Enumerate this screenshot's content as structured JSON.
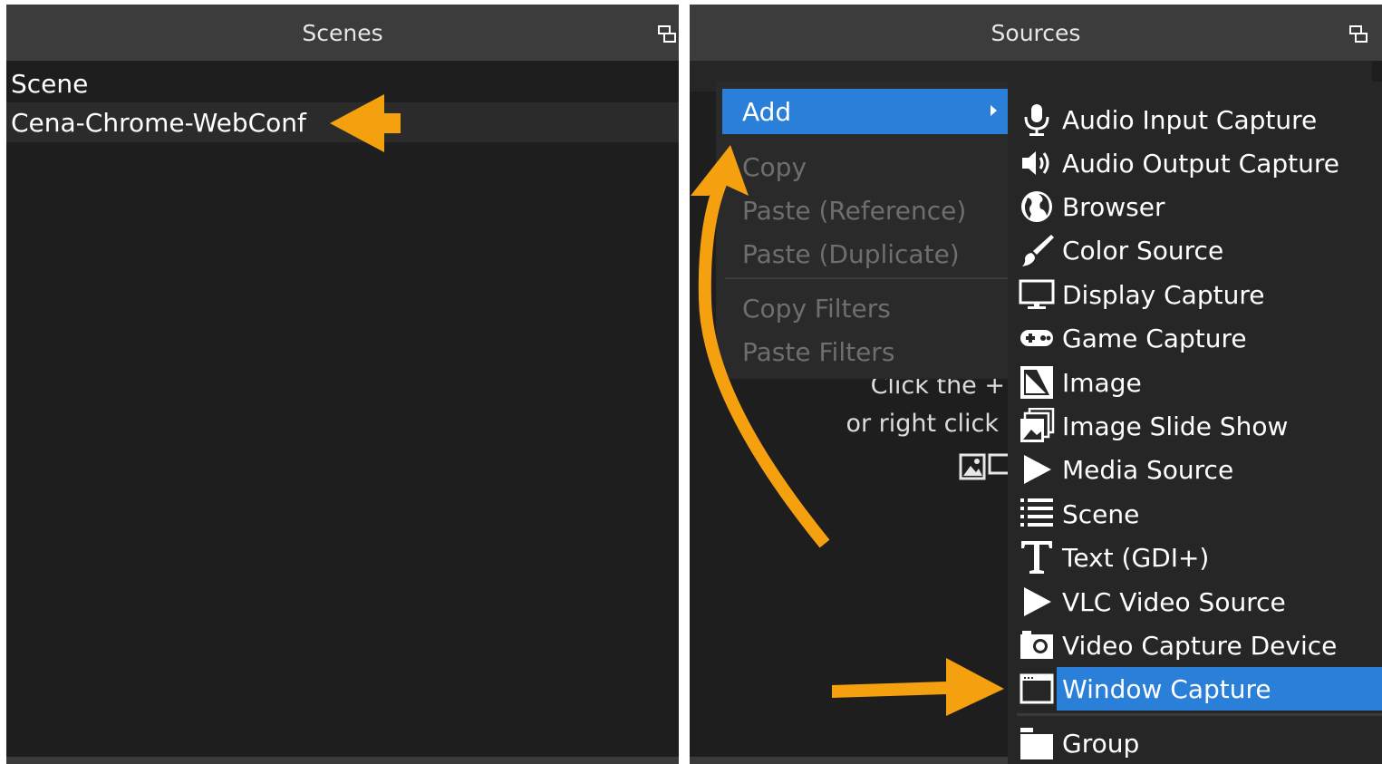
{
  "scenes_panel": {
    "title": "Scenes",
    "items": [
      "Scene",
      "Cena-Chrome-WebConf"
    ]
  },
  "sources_panel": {
    "title": "Sources",
    "hint_line1": "Click the +",
    "hint_line2": "or right click"
  },
  "context_menu": {
    "add": "Add",
    "copy": "Copy",
    "paste_reference": "Paste (Reference)",
    "paste_duplicate": "Paste (Duplicate)",
    "copy_filters": "Copy Filters",
    "paste_filters": "Paste Filters"
  },
  "add_submenu": [
    {
      "label": "Audio Input Capture",
      "icon": "microphone-icon"
    },
    {
      "label": "Audio Output Capture",
      "icon": "speaker-icon"
    },
    {
      "label": "Browser",
      "icon": "globe-icon"
    },
    {
      "label": "Color Source",
      "icon": "paintbrush-icon"
    },
    {
      "label": "Display Capture",
      "icon": "monitor-icon"
    },
    {
      "label": "Game Capture",
      "icon": "gamepad-icon"
    },
    {
      "label": "Image",
      "icon": "image-icon"
    },
    {
      "label": "Image Slide Show",
      "icon": "slideshow-icon"
    },
    {
      "label": "Media Source",
      "icon": "play-icon"
    },
    {
      "label": "Scene",
      "icon": "list-icon"
    },
    {
      "label": "Text (GDI+)",
      "icon": "text-icon"
    },
    {
      "label": "VLC Video Source",
      "icon": "play-icon"
    },
    {
      "label": "Video Capture Device",
      "icon": "camera-icon"
    },
    {
      "label": "Window Capture",
      "icon": "window-icon",
      "highlighted": true
    },
    {
      "label": "Group",
      "icon": "folder-icon"
    }
  ],
  "colors": {
    "highlight": "#2a7fd8",
    "annotation_arrow": "#f5a00f",
    "panel_bg": "#1e1e1e",
    "title_bg": "#3c3c3c"
  }
}
